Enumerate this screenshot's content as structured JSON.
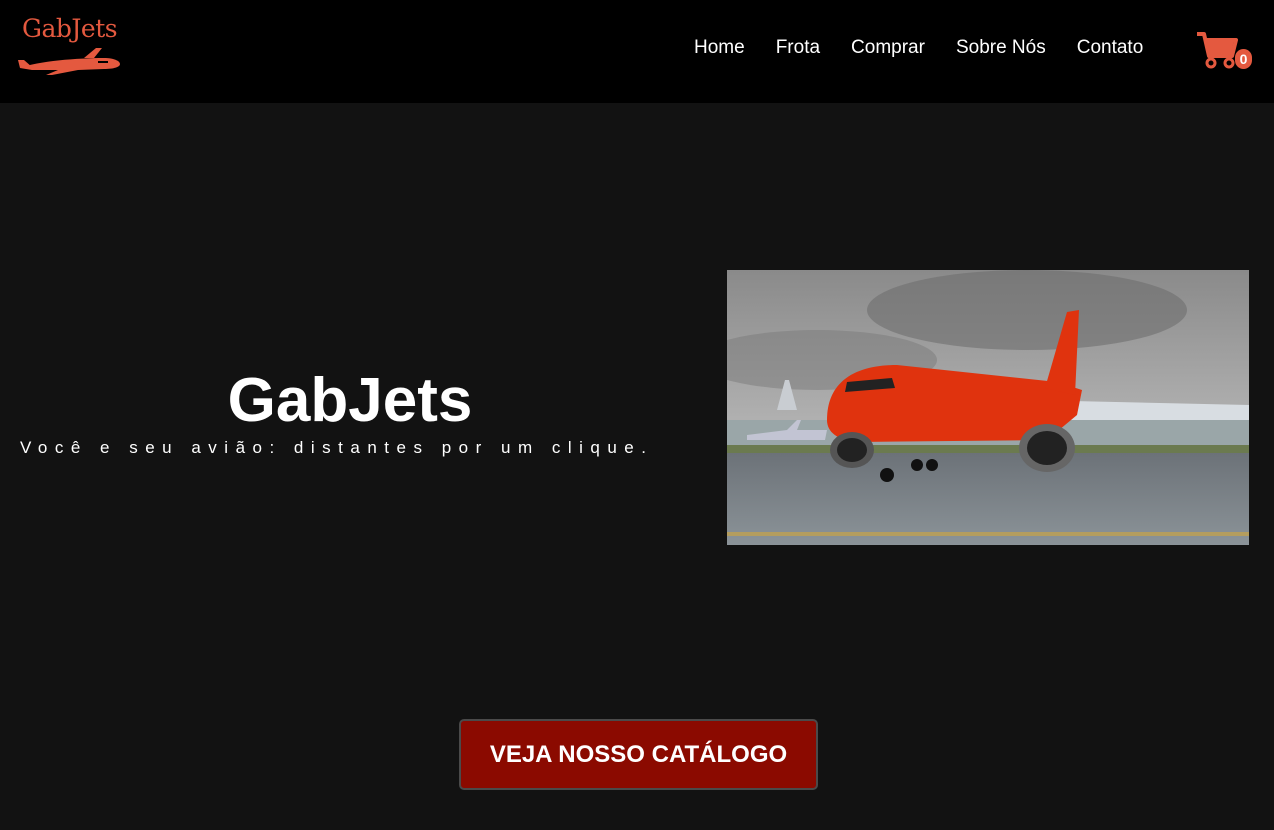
{
  "brand": {
    "name": "GabJets",
    "color": "#e4593f"
  },
  "nav": [
    {
      "id": "home",
      "label": "Home"
    },
    {
      "id": "frota",
      "label": "Frota"
    },
    {
      "id": "comprar",
      "label": "Comprar"
    },
    {
      "id": "sobre",
      "label": "Sobre Nós"
    },
    {
      "id": "contato",
      "label": "Contato"
    }
  ],
  "cart": {
    "icon": "cart-icon",
    "count": "0"
  },
  "hero": {
    "title": "GabJets",
    "subtitle": "Você e seu avião: distantes por um clique.",
    "image_icon": "airplane-photo"
  },
  "cta": {
    "label": "VEJA NOSSO CATÁLOGO",
    "color": "#8b0a00"
  }
}
